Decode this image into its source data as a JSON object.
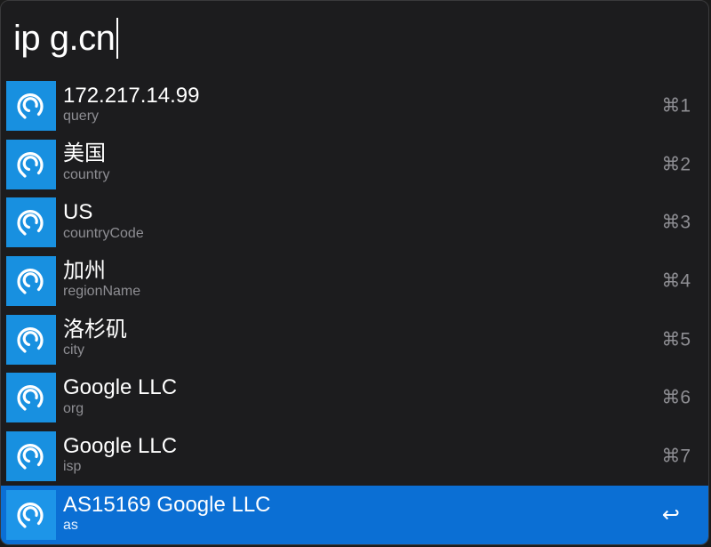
{
  "search": {
    "query": "ip g.cn"
  },
  "results": [
    {
      "title": "172.217.14.99",
      "subtitle": "query",
      "shortcut": "⌘1"
    },
    {
      "title": "美国",
      "subtitle": "country",
      "shortcut": "⌘2"
    },
    {
      "title": "US",
      "subtitle": "countryCode",
      "shortcut": "⌘3"
    },
    {
      "title": "加州",
      "subtitle": "regionName",
      "shortcut": "⌘4"
    },
    {
      "title": "洛杉矶",
      "subtitle": "city",
      "shortcut": "⌘5"
    },
    {
      "title": "Google LLC",
      "subtitle": "org",
      "shortcut": "⌘6"
    },
    {
      "title": "Google LLC",
      "subtitle": "isp",
      "shortcut": "⌘7"
    },
    {
      "title": "AS15169 Google LLC",
      "subtitle": "as",
      "shortcut": "↩"
    }
  ],
  "icon": {
    "name": "location-pin-icon"
  },
  "colors": {
    "background": "#1c1c1e",
    "selected": "#0b6fd4",
    "icon_bg": "#1890e0",
    "subtitle": "#8e8e93"
  }
}
